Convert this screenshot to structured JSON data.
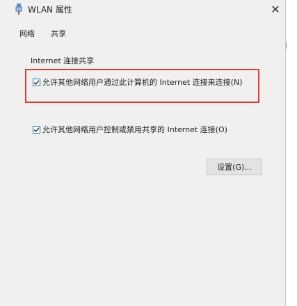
{
  "window": {
    "title": "WLAN 属性",
    "close_glyph": "✕",
    "icon": "wlan-adapter-icon"
  },
  "tabs": [
    {
      "label": "网络"
    },
    {
      "label": "共享"
    }
  ],
  "sharing": {
    "group_title": "Internet 连接共享",
    "allow_connect": {
      "label": "允许其他网络用户通过此计算机的 Internet 连接来连接(N)",
      "checked": true
    },
    "allow_control": {
      "label": "允许其他网络用户控制或禁用共享的 Internet 连接(O)",
      "checked": true
    },
    "settings_button": "设置(G)..."
  },
  "colors": {
    "highlight_border": "#e23d28",
    "checkbox_accent": "#1f6fc5",
    "background": "#f0f0f0"
  }
}
